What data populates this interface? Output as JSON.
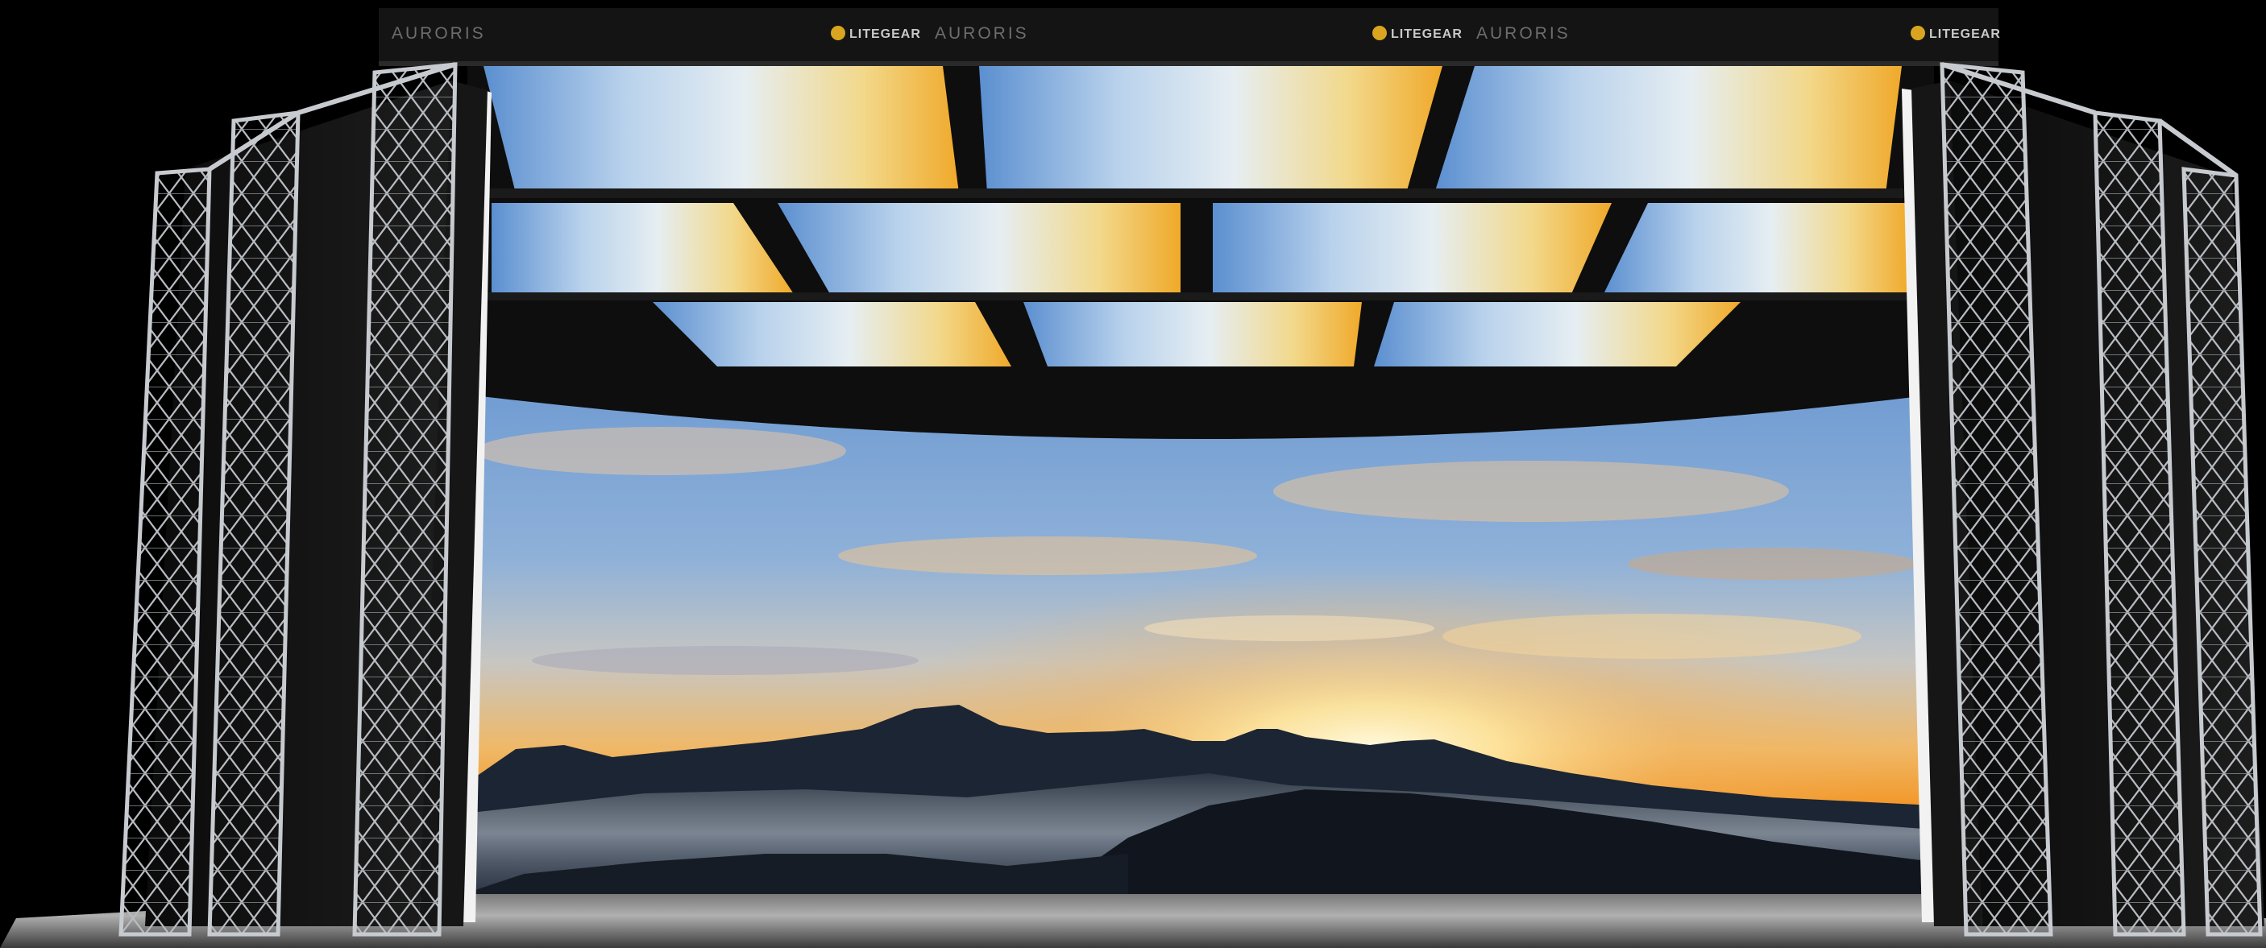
{
  "header_banner": {
    "segments": [
      {
        "brand": "AURORIS",
        "partner": "LITEGEAR"
      },
      {
        "brand": "AURORIS",
        "partner": "LITEGEAR"
      },
      {
        "brand": "AURORIS",
        "partner": "LITEGEAR"
      }
    ]
  },
  "colors": {
    "background": "#000000",
    "sky_top": "#6e9fd6",
    "sky_horizon": "#f2a63a",
    "sun": "#fff3c9",
    "mountains": "#1a2230",
    "truss": "#bfc3c8",
    "floor": "#9a9a9a",
    "logo_gold": "#d9a520"
  }
}
